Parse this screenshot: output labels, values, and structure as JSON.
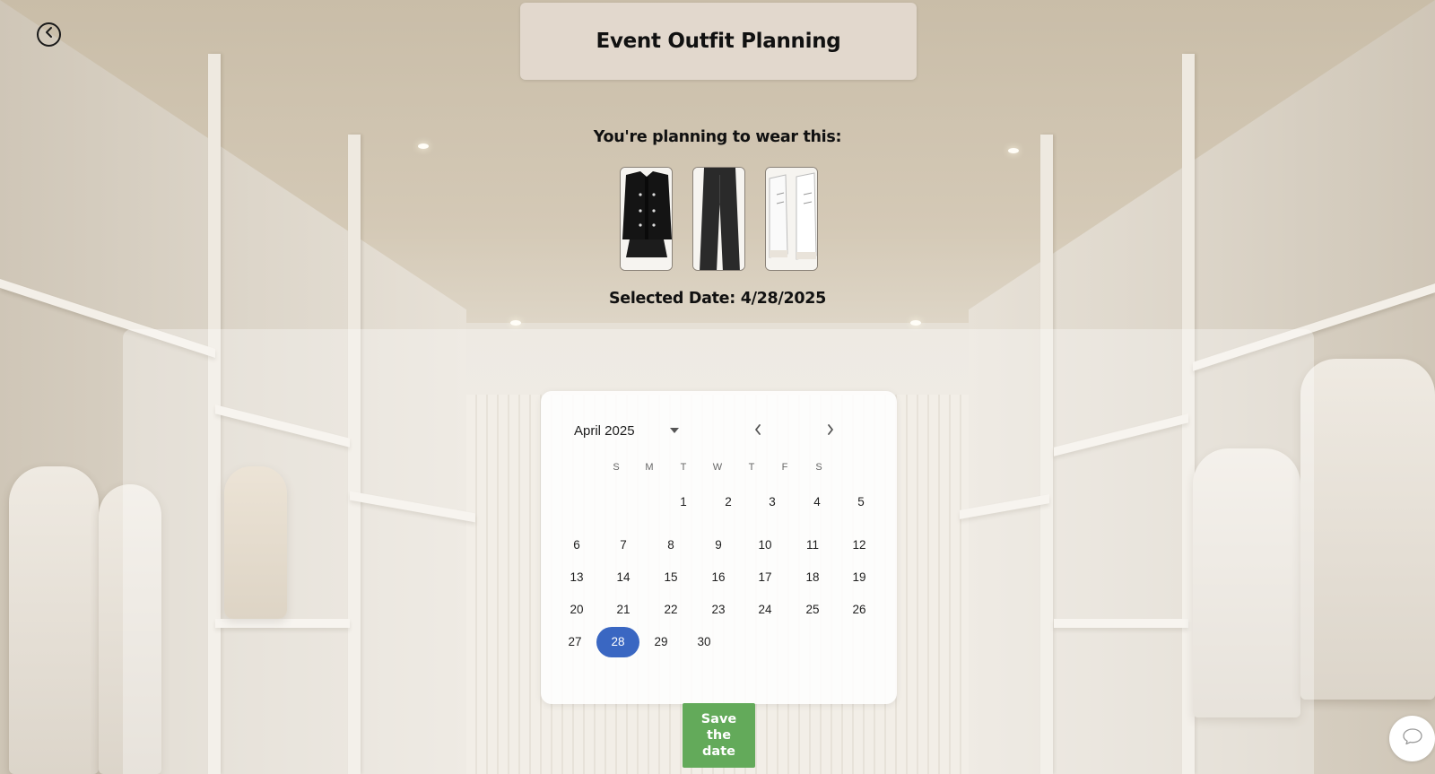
{
  "header": {
    "title": "Event Outfit Planning",
    "back_icon": "chevron-left-icon"
  },
  "outfit": {
    "label": "You're planning to wear this:",
    "items": [
      {
        "name": "black-tweed-jacket"
      },
      {
        "name": "black-wide-leg-jeans"
      },
      {
        "name": "white-high-top-sneakers"
      }
    ]
  },
  "selected_date": "Selected Date: 4/28/2025",
  "calendar": {
    "month_label": "April 2025",
    "weekdays": [
      "S",
      "M",
      "T",
      "W",
      "T",
      "F",
      "S"
    ],
    "days": [
      "1",
      "2",
      "3",
      "4",
      "5",
      "6",
      "7",
      "8",
      "9",
      "10",
      "11",
      "12",
      "13",
      "14",
      "15",
      "16",
      "17",
      "18",
      "19",
      "20",
      "21",
      "22",
      "23",
      "24",
      "25",
      "26",
      "27",
      "28",
      "29",
      "30"
    ],
    "selected_day": "28",
    "selected_color": "#3a67c2"
  },
  "save_button": {
    "line1": "Save",
    "line2": "the",
    "line3": "date",
    "color": "#63aa5a"
  },
  "chat": {
    "icon": "chat-bubble-icon"
  }
}
